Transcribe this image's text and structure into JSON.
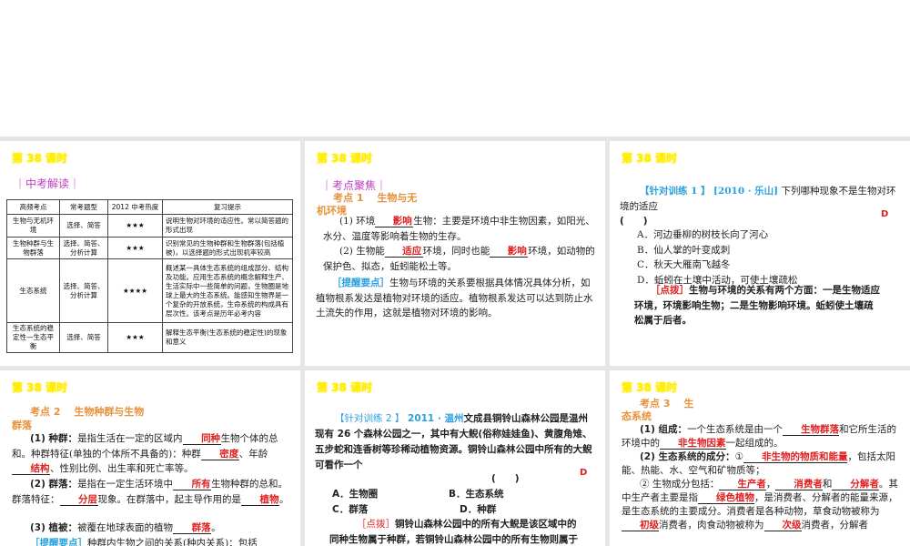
{
  "lesson": "第 38 课时",
  "slide1": {
    "section": "｜中考解读｜",
    "headers": [
      "高频考点",
      "常考题型",
      "2012 中考热度",
      "复习提示"
    ],
    "rows": [
      [
        "生物与无机环境",
        "选择、简答",
        "★★★",
        "说明生物对环境的适应性。常以简答题的形式出现"
      ],
      [
        "生物种群与生物群落",
        "选择、简答、分析计算",
        "★★★",
        "识别常见的生物种群和生物群落(包括植被)，以选择题的形式出现机率较高"
      ],
      [
        "生态系统",
        "选择、简答、分析计算",
        "★★★★",
        "概述某一具体生态系统的组成部分、结构及功能。应用生态系统的概念解释生产、生活实际中一些简单的问题，生物圈是地球上最大的生态系统。能感知生物界是一个复杂的开放系统，生命系统的构成具有层次性。该考点是历年必考内容"
      ],
      [
        "生态系统的稳定性—生态平衡",
        "选择、简答",
        "★★★",
        "解释生态平衡(生态系统的稳定性)的现象和意义"
      ]
    ]
  },
  "slide2": {
    "section": "｜考点聚焦｜",
    "point": "考点 1　 生物与无机环境",
    "p1a": "(1) 环境",
    "p1ans": "影响",
    "p1b": "生物：主要是环境中非生物因素，如阳光、水分、温度等影响着生物的生存。",
    "p2a": "(2) 生物能",
    "p2ans1": "适应",
    "p2b": "环境，同时也能",
    "p2ans2": "影响",
    "p2c": "环境，如动物的保护色、拟态，蚯蚓能松土等。",
    "tip": "［提醒要点］",
    "tiptext": "生物与环境的关系要根据具体情况具体分析，如植物根系发达是植物对环境的适应。植物根系发达可以达到防止水土流失的作用，这就是植物对环境的影响。"
  },
  "slide3": {
    "tag": "【针对训练 1 】",
    "src": "[2010 · 乐山]",
    "q": "下列哪种现象不是生物对环境的适应",
    "paren": "(　　)",
    "answer": "D",
    "options": [
      "A．河边垂柳的树枝长向了河心",
      "B．仙人掌的叶变成刺",
      "C．秋天大雁南飞越冬",
      "D．蚯蚓在土壤中活动，可使土壤疏松"
    ],
    "hint": "［点拨］",
    "hinttext": "生物与环境的关系有两个方面：一是生物适应环境，环境影响生物；二是生物影响环境。蚯蚓使土壤疏松属于后者。"
  },
  "slide4": {
    "point": "考点 2　 生物种群与生物群落",
    "a1": "(1) 种群：",
    "a2": "是指生活在一定的区域内",
    "ans1": "同种",
    "a3": "生物个体的总和。种群特征(单独的个体所不具备的)：种群",
    "ans2": "密度",
    "a4": "、年龄",
    "ans3": "结构",
    "a5": "、性别比例、出生率和死亡率等。",
    "b1": "(2) 群落：",
    "b2": "是指在一定生活环境中",
    "ans4": "所有",
    "b3": "生物种群的总和。群落特征：",
    "ans5": "分层",
    "b4": "现象。在群落中，起主导作用的是",
    "ans6": "植物",
    "b5": "。",
    "c1": "(3) 植被：",
    "c2": "被覆在地球表面的植物",
    "ans7": "群落",
    "c3": "。",
    "tip": "［提醒要点］",
    "tiptext": "种群内生物之间的关系(种内关系)：包括"
  },
  "slide5": {
    "tag": "【针对训练 2 】",
    "src": "2011 · 温州",
    "q": "文成县铜铃山森林公园是温州现有 26 个森林公园之一，其中有大鲵(俗称娃娃鱼)、黄腹角雉、五步蛇和连香树等珍稀动植物资源。铜铃山森林公园中所有的大鲵可看作一个",
    "paren": "(　　)",
    "answer": "D",
    "options": [
      "A．生物圈",
      "B．生态系统",
      "C．群落",
      "D．种群"
    ],
    "hint": "［点拨］",
    "hinttext": "铜铃山森林公园中的所有大鲵是该区域中的同种生物属于种群，若铜铃山森林公园中的所有生物则属于群落，整个铜铃山森林公园则属于一个生态系统。"
  },
  "slide6": {
    "point": "考点 3　 生态系统",
    "a1": "(1) 组成：",
    "a2": "一个生态系统是由一个",
    "ans1": "生物群落",
    "a3": "和它所生活的环境中的",
    "ans2": "非生物因素",
    "a4": "一起组成的。",
    "b1": "(2) 生态系统的成分：",
    "b2": "①",
    "ans3": "非生物的物质和能量",
    "b3": "，包括太阳能、热能、水、空气和矿物质等；",
    "c1": "② 生物成分包括：",
    "ans4": "生产者",
    "ans5": "消费者",
    "c2": "和",
    "ans6": "分解者",
    "c3": "。其中生产者主要是指",
    "ans7": "绿色植物",
    "c4": "，是消费者、分解者的能量来源，是生态系统的主要成分。消费者是各种动物，草食动物被称为",
    "ans8": "初级",
    "c5": "消费者，肉食动物被称为",
    "ans9": "次级",
    "c6": "消费者，分解者"
  }
}
